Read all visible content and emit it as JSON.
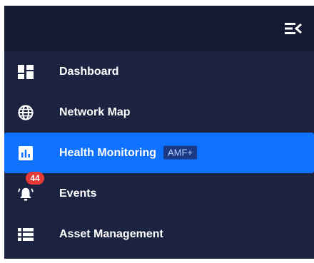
{
  "sidebar": {
    "collapse_icon": "menu-collapse-icon",
    "items": [
      {
        "label": "Dashboard",
        "icon": "dashboard-icon",
        "active": false
      },
      {
        "label": "Network Map",
        "icon": "globe-icon",
        "active": false
      },
      {
        "label": "Health Monitoring",
        "icon": "chart-icon",
        "active": true,
        "tag": "AMF+"
      },
      {
        "label": "Events",
        "icon": "bell-alert-icon",
        "active": false,
        "badge": "44"
      },
      {
        "label": "Asset Management",
        "icon": "list-icon",
        "active": false
      }
    ]
  },
  "colors": {
    "sidebar_bg": "#1b2340",
    "topbar_bg": "#141b33",
    "active_bg": "#0f72ff",
    "badge_bg": "#e53935",
    "tag_bg": "#1a3a86"
  }
}
